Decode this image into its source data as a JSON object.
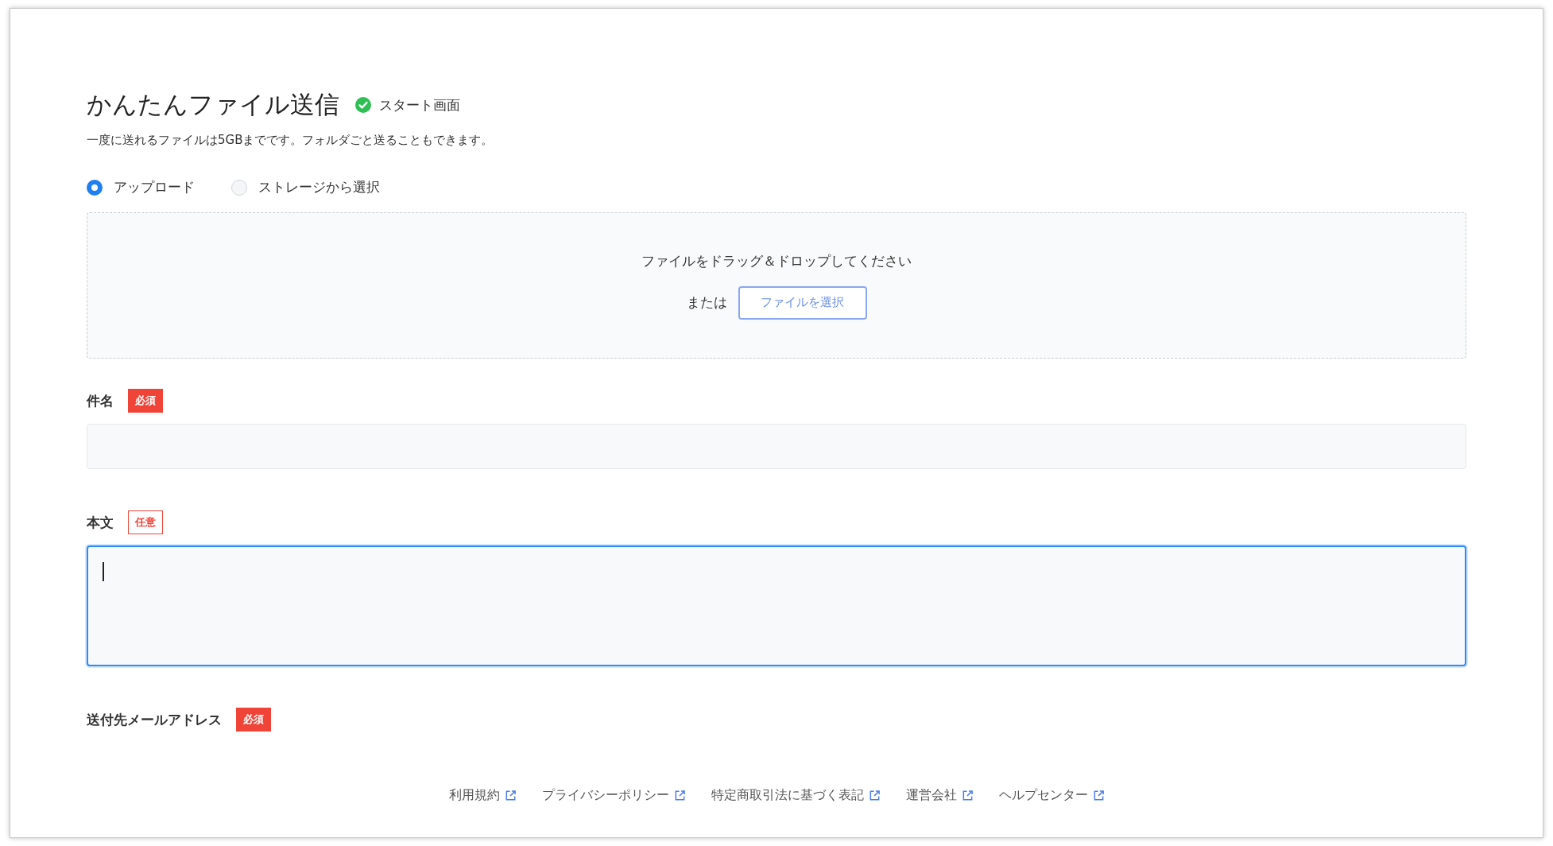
{
  "header": {
    "title": "かんたんファイル送信",
    "status": {
      "label": "スタート画面",
      "done": true
    },
    "description": "一度に送れるファイルは5GBまでです。フォルダごと送ることもできます。"
  },
  "source_options": [
    {
      "label": "アップロード",
      "selected": true
    },
    {
      "label": "ストレージから選択",
      "selected": false
    }
  ],
  "drop_zone": {
    "message": "ファイルをドラッグ＆ドロップしてください",
    "or_text": "または",
    "button": "ファイルを選択"
  },
  "fields": [
    {
      "kind": "line",
      "label": "件名",
      "badge": {
        "kind": "required",
        "text": "必須"
      }
    },
    {
      "kind": "multiline",
      "label": "本文",
      "badge": {
        "kind": "optional",
        "text": "任意"
      },
      "focused": true
    },
    {
      "kind": "label",
      "label": "送付先メールアドレス",
      "badge": {
        "kind": "required",
        "text": "必須"
      }
    }
  ],
  "footer_links": [
    "利用規約",
    "プライバシーポリシー",
    "特定商取引法に基づく表記",
    "運営会社",
    "ヘルプセンター"
  ]
}
